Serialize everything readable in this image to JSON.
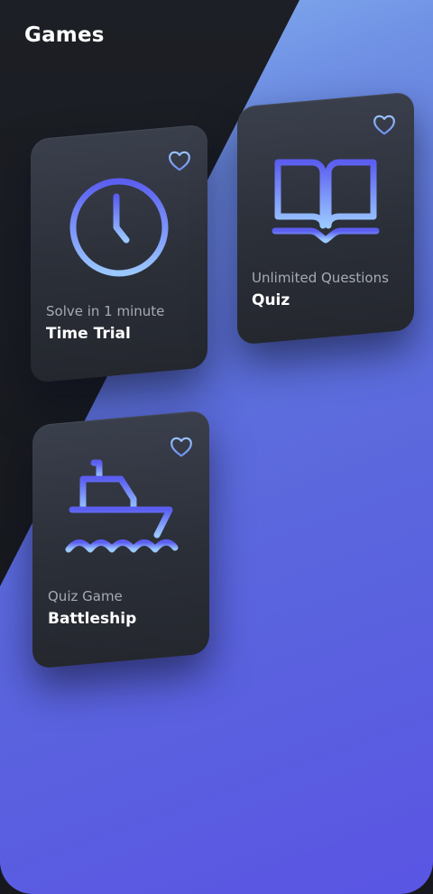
{
  "header": {
    "title": "Games"
  },
  "colors": {
    "accent_top": "#8ab8f2",
    "accent_bottom": "#5a55e4",
    "card": "#2b2f38",
    "icon_gradient_start": "#5b5ef0",
    "icon_gradient_end": "#9bc8ff"
  },
  "games": [
    {
      "subtitle": "Solve in 1 minute",
      "title": "Time Trial",
      "icon": "clock-icon",
      "favorite_icon": "heart-icon"
    },
    {
      "subtitle": "Unlimited Questions",
      "title": "Quiz",
      "icon": "book-icon",
      "favorite_icon": "heart-icon"
    },
    {
      "subtitle": "Quiz Game",
      "title": "Battleship",
      "icon": "ship-icon",
      "favorite_icon": "heart-icon"
    }
  ]
}
